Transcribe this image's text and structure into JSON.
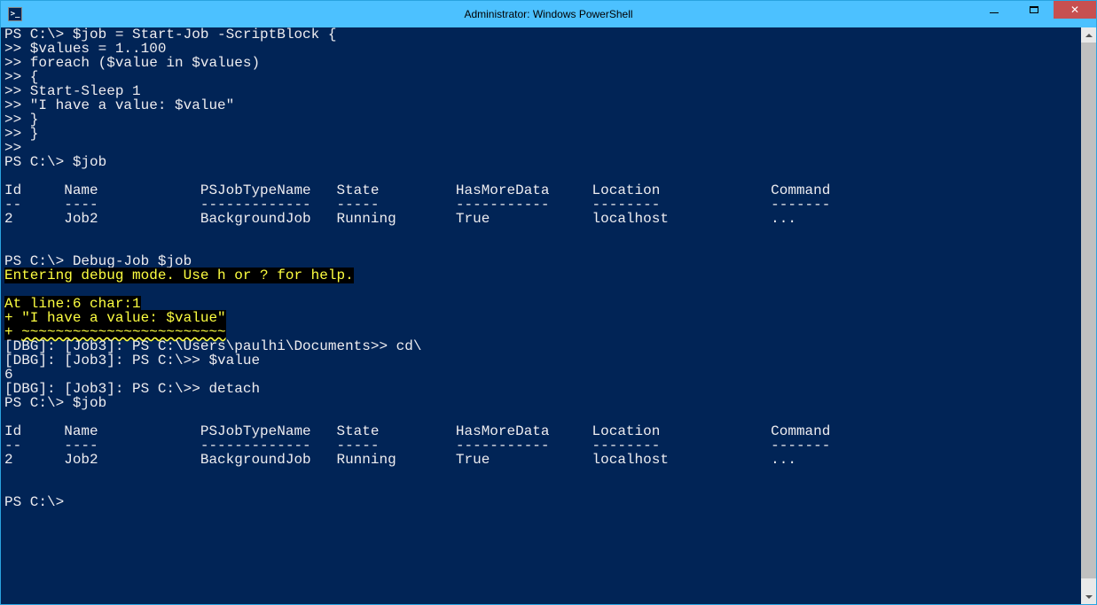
{
  "window": {
    "title": "Administrator: Windows PowerShell",
    "icon_glyph": ">_"
  },
  "terminal": {
    "lines": {
      "l1": "PS C:\\> $job = Start-Job -ScriptBlock {",
      "l2": ">> $values = 1..100",
      "l3": ">> foreach ($value in $values)",
      "l4": ">> {",
      "l5": ">> Start-Sleep 1",
      "l6": ">> \"I have a value: $value\"",
      "l7": ">> }",
      "l8": ">> }",
      "l9": ">>",
      "l10": "PS C:\\> $job",
      "blank": "",
      "hdr": "Id     Name            PSJobTypeName   State         HasMoreData     Location             Command",
      "sep": "--     ----            -------------   -----         -----------     --------             -------",
      "row": "2      Job2            BackgroundJob   Running       True            localhost            ...",
      "l11": "PS C:\\> Debug-Job $job",
      "hl1": "Entering debug mode. Use h or ? for help.",
      "hl2": "At line:6 char:1",
      "hl3": "+ \"I have a value: $value\"",
      "hl4a": "+ ",
      "hl4b": "~~~~~~~~~~~~~~~~~~~~~~~~",
      "d1": "[DBG]: [Job3]: PS C:\\Users\\paulhi\\Documents>> cd\\",
      "d2": "[DBG]: [Job3]: PS C:\\>> $value",
      "d3": "6",
      "d4": "[DBG]: [Job3]: PS C:\\>> detach",
      "l12": "PS C:\\> $job",
      "final": "PS C:\\>"
    }
  }
}
